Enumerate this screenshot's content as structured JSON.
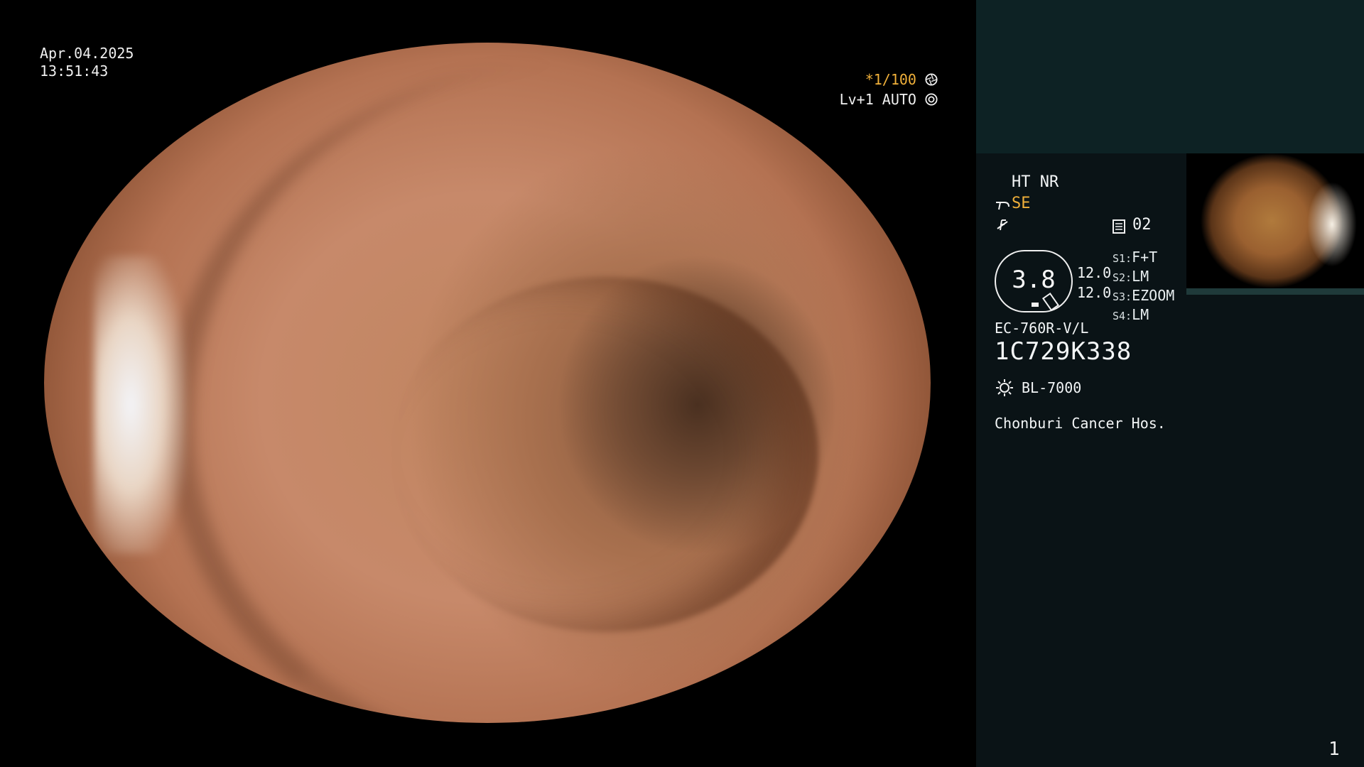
{
  "overlay": {
    "date": "Apr.04.2025",
    "time": "13:51:43",
    "shutter": "*1/100",
    "level": "Lv+1 AUTO",
    "shutter_icon": "aperture-icon",
    "auto_icon": "iris-icon"
  },
  "side": {
    "mode": "HT NR",
    "enhance": "SE",
    "enhance_icon": "scope-icon",
    "f_icon": "struck-f-icon",
    "rec_icon": "memory-icon",
    "rec_value": "02",
    "zoom_value": "3.8",
    "val1": "12.0",
    "val2": "12.0",
    "s1_label": "S1:",
    "s1_value": "F+T",
    "s2_label": "S2:",
    "s2_value": "LM",
    "s3_label": "S3:",
    "s3_value": "EZOOM",
    "s4_label": "S4:",
    "s4_value": "LM",
    "scope_model": "EC-760R-V/L",
    "serial": "1C729K338",
    "light_icon": "light-source-icon",
    "light_model": "BL-7000",
    "hospital": "Chonburi Cancer Hos."
  },
  "page_number": "1",
  "colors": {
    "accent": "#f0b03a",
    "panel_top": "#0d2224",
    "panel_bottom": "#0a1316"
  }
}
